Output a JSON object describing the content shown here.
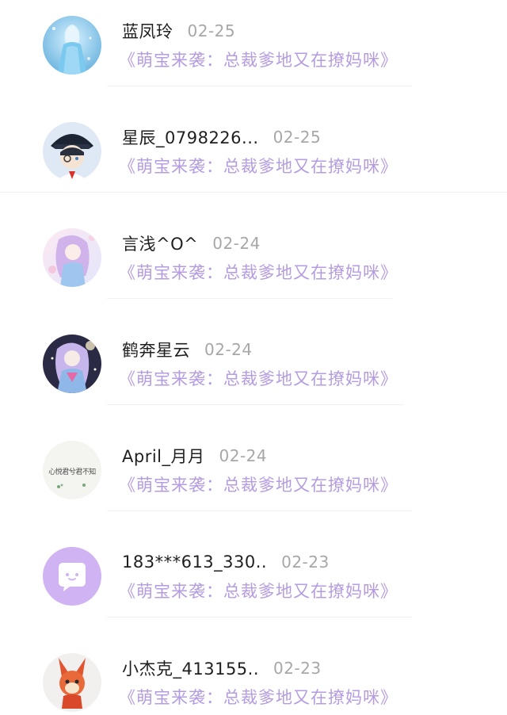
{
  "colors": {
    "name": "#1f1f1f",
    "date": "#a7a7a7",
    "book_title": "#b59ce0",
    "default_avatar": "#cfb3f2"
  },
  "items": [
    {
      "name": "蓝凤玲",
      "date": "02-25",
      "book": "《萌宝来袭：总裁爹地又在撩妈咪》",
      "avatar": "ice-princess-avatar"
    },
    {
      "name": "星辰_0798226...",
      "date": "02-25",
      "book": "《萌宝来袭：总裁爹地又在撩妈咪》",
      "avatar": "detective-boy-avatar"
    },
    {
      "name": "言浅^O^",
      "date": "02-24",
      "book": "《萌宝来袭：总裁爹地又在撩妈咪》",
      "avatar": "pastel-girl-avatar"
    },
    {
      "name": "鹤奔星云",
      "date": "02-24",
      "book": "《萌宝来袭：总裁爹地又在撩妈咪》",
      "avatar": "night-girl-avatar"
    },
    {
      "name": "April_月月",
      "date": "02-24",
      "book": "《萌宝来袭：总裁爹地又在撩妈咪》",
      "avatar": "calligraphy-avatar",
      "avatar_text": "心悦君兮君不知"
    },
    {
      "name": "183***613_330..",
      "date": "02-23",
      "book": "《萌宝来袭：总裁爹地又在撩妈咪》",
      "avatar": "default-chat-avatar"
    },
    {
      "name": "小杰克_413155..",
      "date": "02-23",
      "book": "《萌宝来袭：总裁爹地又在撩妈咪》",
      "avatar": "cartoon-rabbit-avatar"
    }
  ]
}
